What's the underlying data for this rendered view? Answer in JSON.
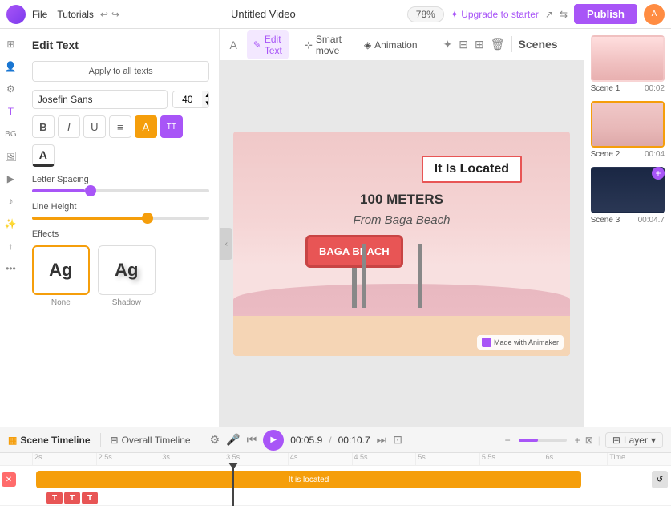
{
  "topbar": {
    "logo_text": "A",
    "file": "File",
    "tutorials": "Tutorials",
    "title": "Untitled Video",
    "zoom": "78%",
    "upgrade": "✦ Upgrade to starter",
    "publish": "Publish"
  },
  "left_panel": {
    "title": "Edit Text",
    "apply_all": "Apply to all texts",
    "font_family": "Josefin Sans",
    "font_size": "40",
    "letter_spacing_label": "Letter Spacing",
    "line_height_label": "Line Height",
    "effects_label": "Effects",
    "effects": [
      {
        "name": "none-effect",
        "label": "None",
        "text": "Ag"
      },
      {
        "name": "shadow-effect",
        "label": "Shadow",
        "text": "Ag"
      }
    ]
  },
  "toolbar": {
    "edit_text": "Edit Text",
    "smart_move": "Smart move",
    "animation": "Animation",
    "scenes_label": "Scenes"
  },
  "canvas": {
    "beach_sign": "BAGA BEACH",
    "is_located": "It Is Located",
    "hundred_meters": "100 METERS",
    "from_baga": "From Baga Beach",
    "animaker": "Made with Animaker"
  },
  "scenes": [
    {
      "name": "Scene 1",
      "time": "00:02",
      "active": false
    },
    {
      "name": "Scene 2",
      "time": "00:04",
      "active": true
    },
    {
      "name": "Scene 3",
      "time": "00:04.7",
      "active": false
    }
  ],
  "timeline": {
    "scene_timeline": "Scene Timeline",
    "overall_timeline": "Overall Timeline",
    "current_time": "00:05.9",
    "total_time": "00:10.7",
    "layer": "Layer",
    "track_label": "It is located",
    "ruler_marks": [
      "2s",
      "2.5s",
      "3s",
      "3.5s",
      "4s",
      "4.5s",
      "5s",
      "5.5s",
      "6s",
      "Time"
    ]
  },
  "icons": {
    "templates": "⊞",
    "character": "👤",
    "property": "⚙",
    "text": "T",
    "bg": "🖼",
    "image": "🖼",
    "video": "▶",
    "music": "♪",
    "effect": "✨",
    "uploads": "↑",
    "more": "•••",
    "undo": "↩",
    "redo": "↪",
    "share": "↗",
    "collab": "👥",
    "settings": "⚙",
    "bold": "B",
    "italic": "I",
    "underline": "U",
    "align": "≡",
    "highlight": "A",
    "transform": "TT",
    "color": "A"
  }
}
